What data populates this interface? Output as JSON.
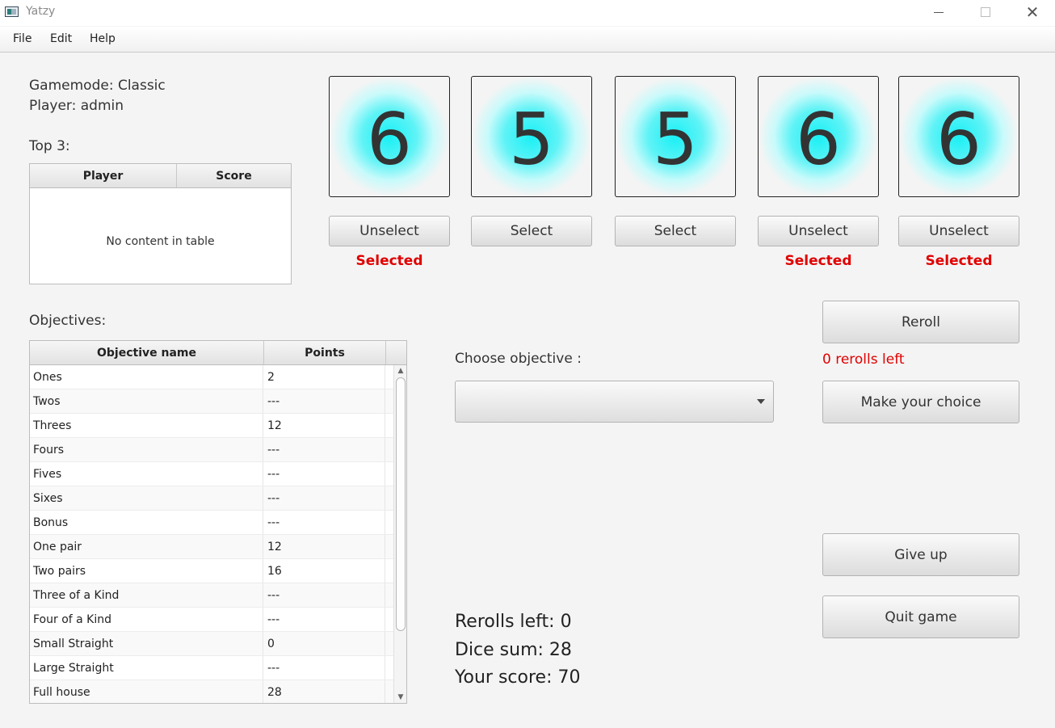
{
  "window": {
    "title": "Yatzy"
  },
  "menu": [
    "File",
    "Edit",
    "Help"
  ],
  "info": {
    "gamemode": "Gamemode: Classic",
    "player": "Player: admin",
    "top3_label": "Top 3:"
  },
  "top3_table": {
    "columns": [
      "Player",
      "Score"
    ],
    "empty_message": "No content in table"
  },
  "objectives": {
    "label": "Objectives:",
    "columns": [
      "Objective name",
      "Points"
    ],
    "rows": [
      [
        "Ones",
        "2"
      ],
      [
        "Twos",
        "---"
      ],
      [
        "Threes",
        "12"
      ],
      [
        "Fours",
        "---"
      ],
      [
        "Fives",
        "---"
      ],
      [
        "Sixes",
        "---"
      ],
      [
        "Bonus",
        "---"
      ],
      [
        "One pair",
        "12"
      ],
      [
        "Two pairs",
        "16"
      ],
      [
        "Three of a Kind",
        "---"
      ],
      [
        "Four of a Kind",
        "---"
      ],
      [
        "Small Straight",
        "0"
      ],
      [
        "Large Straight",
        "---"
      ],
      [
        "Full house",
        "28"
      ]
    ]
  },
  "dice": [
    {
      "value": "6",
      "button": "Unselect",
      "status": "Selected"
    },
    {
      "value": "5",
      "button": "Select",
      "status": ""
    },
    {
      "value": "5",
      "button": "Select",
      "status": ""
    },
    {
      "value": "6",
      "button": "Unselect",
      "status": "Selected"
    },
    {
      "value": "6",
      "button": "Unselect",
      "status": "Selected"
    }
  ],
  "choose": {
    "label": "Choose objective :",
    "selected": ""
  },
  "actions": {
    "reroll": "Reroll",
    "rerolls_left_msg": "0 rerolls left",
    "make_choice": "Make your choice",
    "give_up": "Give up",
    "quit": "Quit game"
  },
  "stats": {
    "rerolls": "Rerolls left: 0",
    "dice_sum": "Dice sum: 28",
    "score": "Your score: 70"
  },
  "colors": {
    "accent_red": "#e00000",
    "die_glow": "#19f0f5"
  }
}
